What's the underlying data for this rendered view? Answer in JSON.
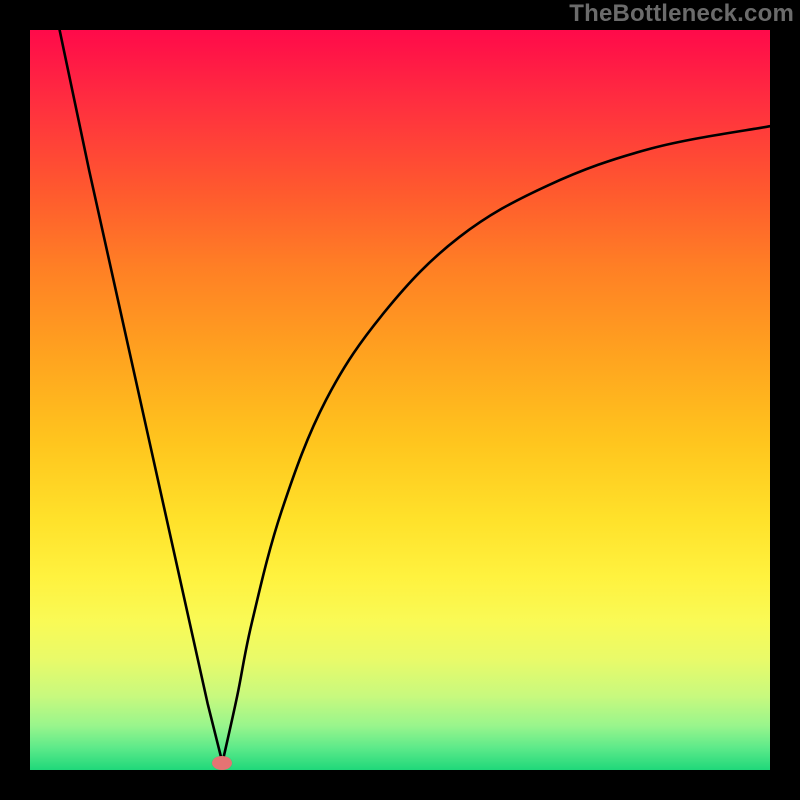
{
  "watermark": "TheBottleneck.com",
  "marker": {
    "x_pct": 26.0,
    "y_pct": 99.0,
    "color": "#e57373"
  },
  "chart_data": {
    "type": "line",
    "title": "",
    "xlabel": "",
    "ylabel": "",
    "xlim": [
      0,
      100
    ],
    "ylim": [
      0,
      100
    ],
    "series": [
      {
        "name": "left-branch",
        "x": [
          4,
          8,
          12,
          16,
          20,
          24,
          26
        ],
        "y": [
          100,
          81,
          63,
          45,
          27,
          9,
          1
        ]
      },
      {
        "name": "right-branch",
        "x": [
          26,
          28,
          30,
          34,
          40,
          48,
          58,
          70,
          84,
          100
        ],
        "y": [
          1,
          10,
          20,
          35,
          50,
          62,
          72,
          79,
          84,
          87
        ]
      }
    ],
    "annotations": [
      {
        "type": "marker",
        "x": 26,
        "y": 1,
        "style": "pink-oval"
      }
    ],
    "background_gradient": [
      "#ff0a4a",
      "#ff5a2e",
      "#ffa31f",
      "#ffe12a",
      "#f9fa56",
      "#99f58c",
      "#1fd87a"
    ]
  }
}
